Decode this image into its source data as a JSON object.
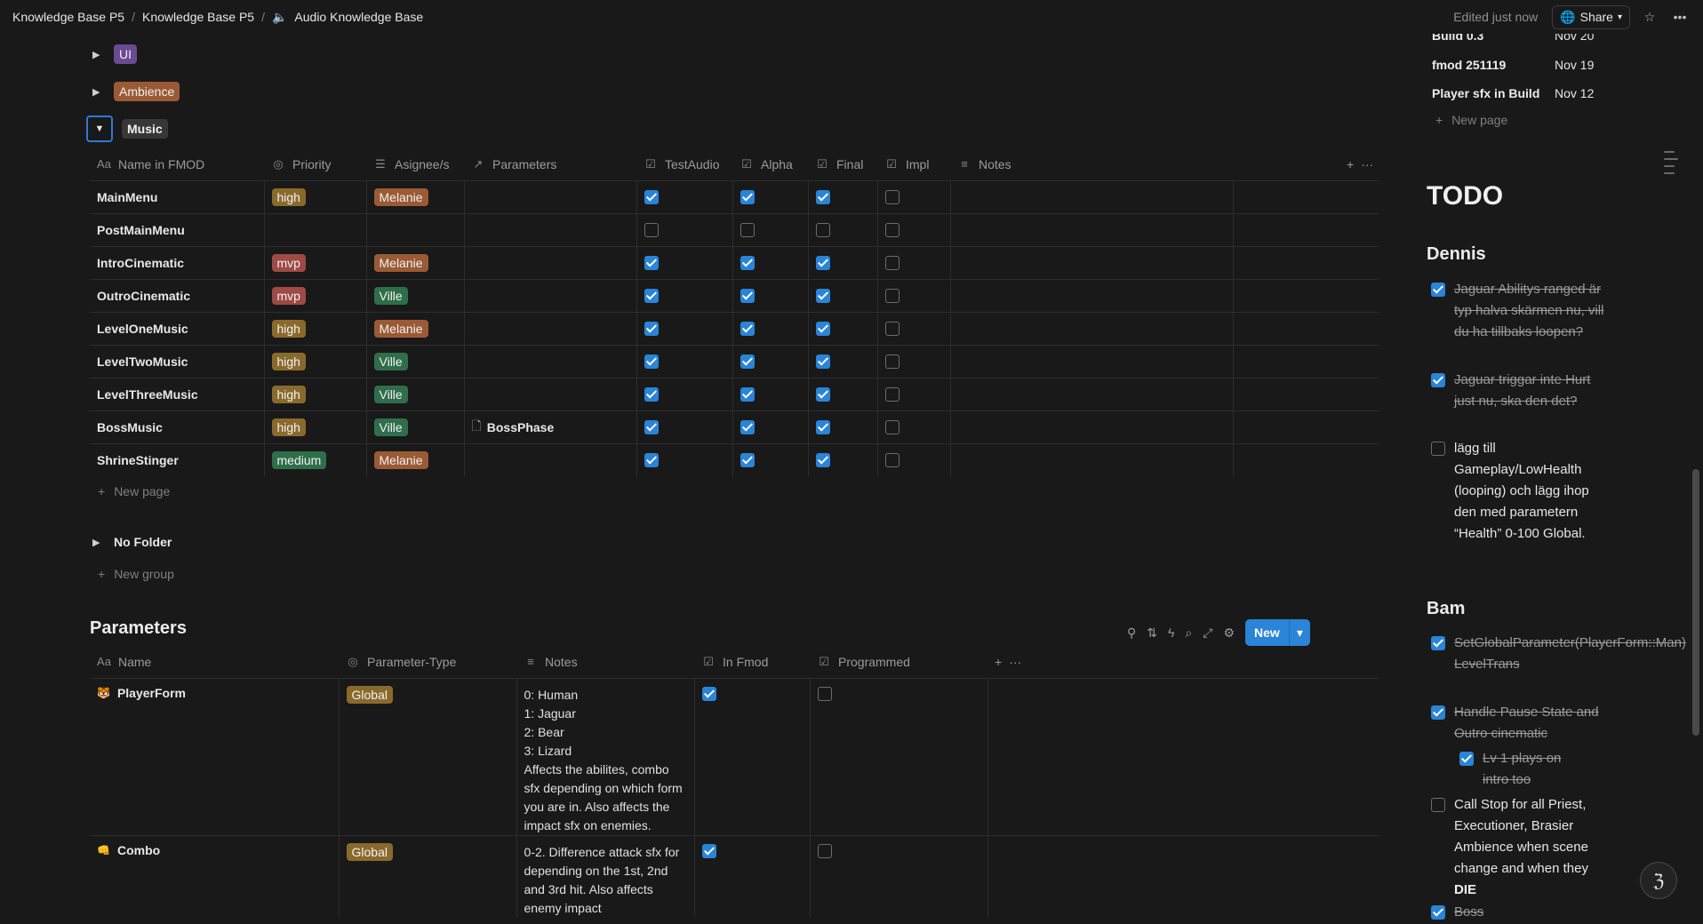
{
  "breadcrumb": {
    "items": [
      "Knowledge Base P5",
      "Knowledge Base P5",
      "Audio Knowledge Base"
    ]
  },
  "topbar": {
    "edited": "Edited just now",
    "share_label": "Share"
  },
  "groups": {
    "ui": "UI",
    "ambience": "Ambience",
    "music": "Music",
    "no_folder": "No Folder",
    "new_page": "New page",
    "new_group": "New group"
  },
  "music_table": {
    "columns": [
      "Name in FMOD",
      "Priority",
      "Asignee/s",
      "Parameters",
      "TestAudio",
      "Alpha",
      "Final",
      "Impl",
      "Notes"
    ],
    "rows": [
      {
        "name": "MainMenu",
        "priority": "high",
        "assignee": "Melanie",
        "param": "",
        "test": true,
        "alpha": true,
        "final": true,
        "impl": false
      },
      {
        "name": "PostMainMenu",
        "priority": "",
        "assignee": "",
        "param": "",
        "test": false,
        "alpha": false,
        "final": false,
        "impl": false
      },
      {
        "name": "IntroCinematic",
        "priority": "mvp",
        "assignee": "Melanie",
        "param": "",
        "test": true,
        "alpha": true,
        "final": true,
        "impl": false
      },
      {
        "name": "OutroCinematic",
        "priority": "mvp",
        "assignee": "Ville",
        "param": "",
        "test": true,
        "alpha": true,
        "final": true,
        "impl": false
      },
      {
        "name": "LevelOneMusic",
        "priority": "high",
        "assignee": "Melanie",
        "param": "",
        "test": true,
        "alpha": true,
        "final": true,
        "impl": false
      },
      {
        "name": "LevelTwoMusic",
        "priority": "high",
        "assignee": "Ville",
        "param": "",
        "test": true,
        "alpha": true,
        "final": true,
        "impl": false
      },
      {
        "name": "LevelThreeMusic",
        "priority": "high",
        "assignee": "Ville",
        "param": "",
        "test": true,
        "alpha": true,
        "final": true,
        "impl": false
      },
      {
        "name": "BossMusic",
        "priority": "high",
        "assignee": "Ville",
        "param": "BossPhase",
        "test": true,
        "alpha": true,
        "final": true,
        "impl": false
      },
      {
        "name": "ShrineStinger",
        "priority": "medium",
        "assignee": "Melanie",
        "param": "",
        "test": true,
        "alpha": true,
        "final": true,
        "impl": false
      }
    ]
  },
  "parameters": {
    "title": "Parameters",
    "new_label": "New",
    "columns": [
      "Name",
      "Parameter-Type",
      "Notes",
      "In Fmod",
      "Programmed"
    ],
    "rows": [
      {
        "icon": "tiger-icon",
        "name": "PlayerForm",
        "type": "Global",
        "notes": [
          "0: Human",
          "1: Jaguar",
          "2: Bear",
          "3: Lizard",
          "Affects the abilites, combo sfx depending on which form you are in. Also affects the impact sfx on enemies."
        ],
        "in_fmod": true,
        "programmed": false
      },
      {
        "icon": "fist-icon",
        "name": "Combo",
        "type": "Global",
        "notes": [
          "0-2. Difference attack sfx for depending on the 1st, 2nd and 3rd hit. Also affects enemy impact"
        ],
        "in_fmod": true,
        "programmed": false
      }
    ]
  },
  "sidebar": {
    "recent": [
      {
        "title": "Build 0.3",
        "date": "Nov 20"
      },
      {
        "title": "fmod 251119",
        "date": "Nov 19"
      },
      {
        "title": "Player sfx in Build",
        "date": "Nov 12"
      }
    ],
    "new_page": "New page",
    "todo_title": "TODO",
    "dennis": "Dennis",
    "dennis_items": [
      {
        "text": "Jaguar Abilitys ranged är typ halva skärmen nu, vill du ha tillbaks loopen?",
        "done": true
      },
      {
        "text": "Jaguar triggar inte Hurt just nu, ska den det?",
        "done": true
      },
      {
        "text": "lägg till Gameplay/LowHealth (looping) och lägg ihop den med parametern “Health” 0-100 Global.",
        "done": false
      }
    ],
    "bam": "Bam",
    "bam_items": [
      {
        "text": "SetGlobalParameter(PlayerForm::Man) LevelTrans",
        "done": true
      },
      {
        "text": "Handle Pause State and Outro cinematic",
        "done": true
      },
      {
        "text": "Lv 1 plays on intro too",
        "done": true
      },
      {
        "text": "Call Stop for all Priest, Executioner, Brasier Ambience when scene change and when they",
        "bold_tail": "DIE",
        "done": false
      },
      {
        "text": "Boss",
        "done": true
      }
    ]
  },
  "colors": {
    "accent": "#2a84d7",
    "tag_ui": "#6b4a94",
    "tag_ambience": "#9a5a35",
    "tag_music": "#373737",
    "pill_high": "#8a6a2c",
    "pill_mvp": "#9e4a45",
    "pill_medium": "#2f6e4a",
    "pill_melanie": "#9a5a35",
    "pill_ville": "#2f6e4a",
    "pill_global": "#8a6a2c"
  }
}
